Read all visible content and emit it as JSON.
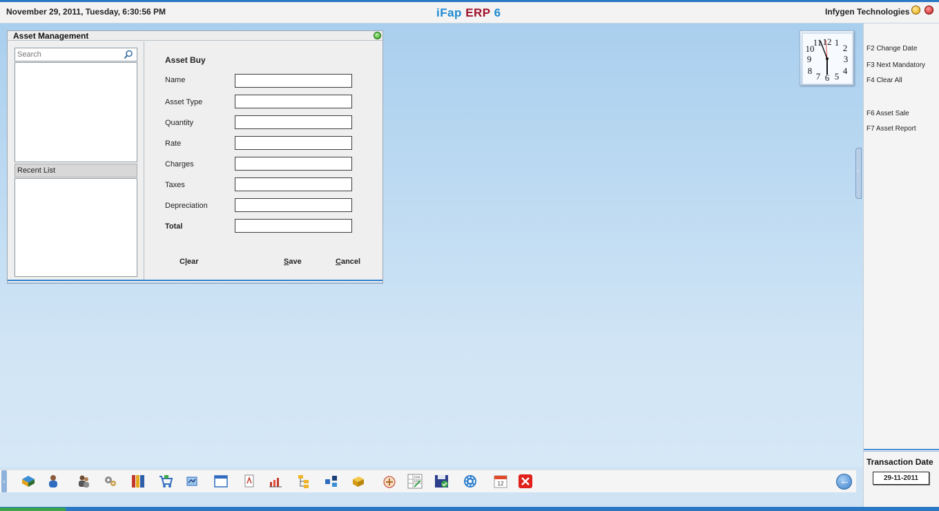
{
  "topbar": {
    "datetime": "November  29, 2011, Tuesday, 6:30:56 PM",
    "brand_part1": "iFap",
    "brand_part2": "ERP",
    "brand_part3": "6",
    "company": "Infygen Technologies",
    "colors": {
      "brand_blue": "#1d8ad1",
      "brand_red": "#a0102a"
    }
  },
  "window": {
    "title": "Asset Management",
    "search_placeholder": "Search",
    "recent_list_label": "Recent List",
    "form": {
      "title": "Asset Buy",
      "fields": [
        {
          "label": "Name",
          "value": ""
        },
        {
          "label": "Asset Type",
          "value": ""
        },
        {
          "label": "Quantity",
          "value": ""
        },
        {
          "label": "Rate",
          "value": ""
        },
        {
          "label": "Charges",
          "value": ""
        },
        {
          "label": "Taxes",
          "value": ""
        },
        {
          "label": "Depreciation",
          "value": ""
        },
        {
          "label": "Total",
          "value": ""
        }
      ],
      "buttons": {
        "clear_first": "C",
        "clear_underline": "l",
        "clear_rest": "ear",
        "save_underline": "S",
        "save_rest": "ave",
        "cancel_underline": "C",
        "cancel_rest": "ancel"
      }
    }
  },
  "right_panel": {
    "shortcuts": [
      "F2 Change Date",
      "F3 Next Mandatory",
      "F4 Clear All",
      "F6 Asset Sale",
      "F7 Asset Report"
    ],
    "transaction_date_label": "Transaction Date",
    "transaction_date_value": "29-11-2011"
  },
  "taskbar": {
    "icons": [
      "accounts-icon",
      "contacts-icon",
      "users-icon",
      "settings-icon",
      "books-icon",
      "cart-icon",
      "transfer-icon",
      "window-icon",
      "document-icon",
      "chart-icon",
      "tree-icon",
      "network-icon",
      "package-icon",
      "tools-icon",
      "spreadsheet-icon",
      "save-icon",
      "gear-icon",
      "calendar-icon",
      "close-icon"
    ],
    "calendar_day": "12",
    "spreadsheet_text_1": "3,144",
    "spreadsheet_text_2": "5,134"
  },
  "clock": {
    "numbers": [
      "12",
      "1",
      "2",
      "3",
      "4",
      "5",
      "6",
      "7",
      "8",
      "9",
      "10",
      "11"
    ]
  }
}
